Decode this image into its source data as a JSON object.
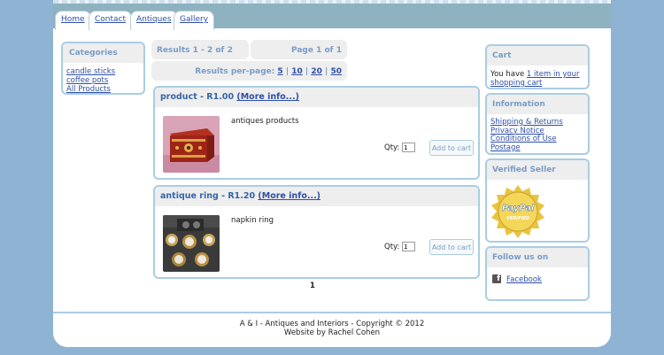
{
  "nav": {
    "tabs": [
      {
        "label": "Home"
      },
      {
        "label": "Contact"
      },
      {
        "label": "Antiques"
      },
      {
        "label": "Gallery"
      }
    ]
  },
  "categories": {
    "title": "Categories",
    "items": [
      "candle sticks",
      "coffee pots",
      "All Products"
    ]
  },
  "results": {
    "summary": "Results 1 - 2 of 2",
    "page": "Page 1 of 1",
    "per_page_label": "Results per-page:",
    "per_page_options": [
      "5",
      "10",
      "20",
      "50"
    ],
    "separator": "|"
  },
  "products": [
    {
      "title": "product - R1.00",
      "more_info": "(More info...)",
      "description": "antiques products",
      "qty_label": "Qty:",
      "qty_value": "1",
      "add_to_cart": "Add to cart"
    },
    {
      "title": "antique ring - R1.20",
      "more_info": "(More info...)",
      "description": "napkin ring",
      "qty_label": "Qty:",
      "qty_value": "1",
      "add_to_cart": "Add to cart"
    }
  ],
  "pagination": {
    "current": "1"
  },
  "cart": {
    "title": "Cart",
    "text_prefix": "You have",
    "link": "1 item in your shopping cart"
  },
  "information": {
    "title": "Information",
    "links": [
      "Shipping & Returns",
      "Privacy Notice",
      "Conditions of Use",
      "Postage"
    ]
  },
  "verified": {
    "title": "Verified Seller",
    "badge_top": "PayPal",
    "badge_bottom": "VERIFIED"
  },
  "follow": {
    "title": "Follow us on",
    "facebook": "Facebook"
  },
  "footer": {
    "line1": "A & I - Antiques and Interiors - Copyright © 2012",
    "line2": "Website by Rachel Cohen"
  },
  "colors": {
    "page_bg": "#8fb3d3",
    "nav_bg": "#8eb2c0",
    "box_border": "#a9cde3",
    "heading": "#7a9cc6",
    "link": "#2e4fa8"
  }
}
